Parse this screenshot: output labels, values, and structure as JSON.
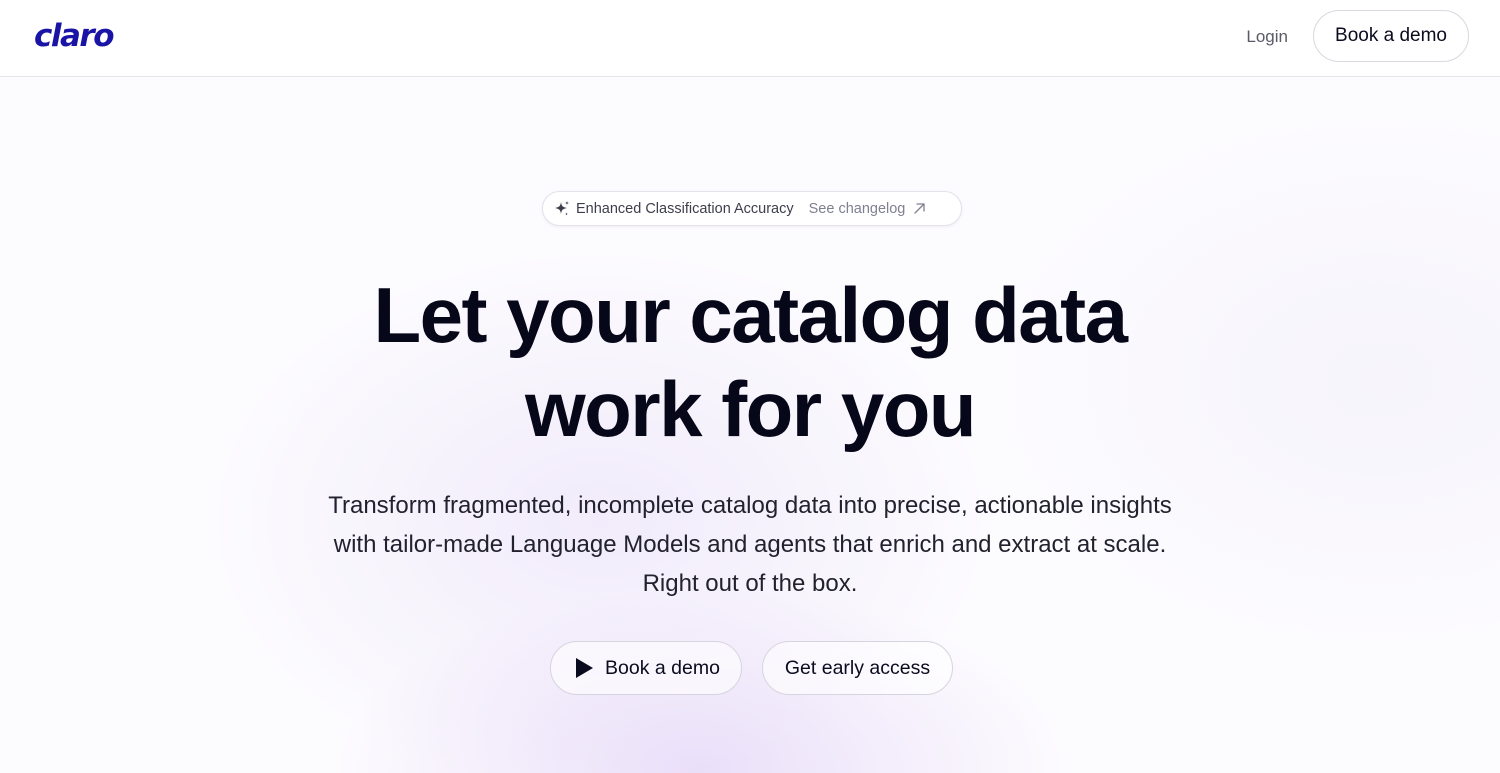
{
  "header": {
    "logo": "claro",
    "login_label": "Login",
    "demo_label": "Book a demo"
  },
  "announcement": {
    "icon": "sparkle-icon",
    "title": "Enhanced Classification Accuracy",
    "link_label": "See changelog",
    "link_icon": "arrow-up-right-icon"
  },
  "hero": {
    "headline_line1": "Let your catalog data",
    "headline_line2": "work for you",
    "sub_line1": "Transform fragmented, incomplete catalog data into precise, actionable insights",
    "sub_line2": "with tailor-made Language Models and agents that enrich and extract at scale.",
    "sub_line3": "Right out of the box."
  },
  "cta": {
    "demo_icon": "play-icon",
    "demo_label": "Book a demo",
    "access_label": "Get early access"
  },
  "colors": {
    "brand": "#1a14a6",
    "text": "#07071a",
    "muted": "#7f8090"
  }
}
